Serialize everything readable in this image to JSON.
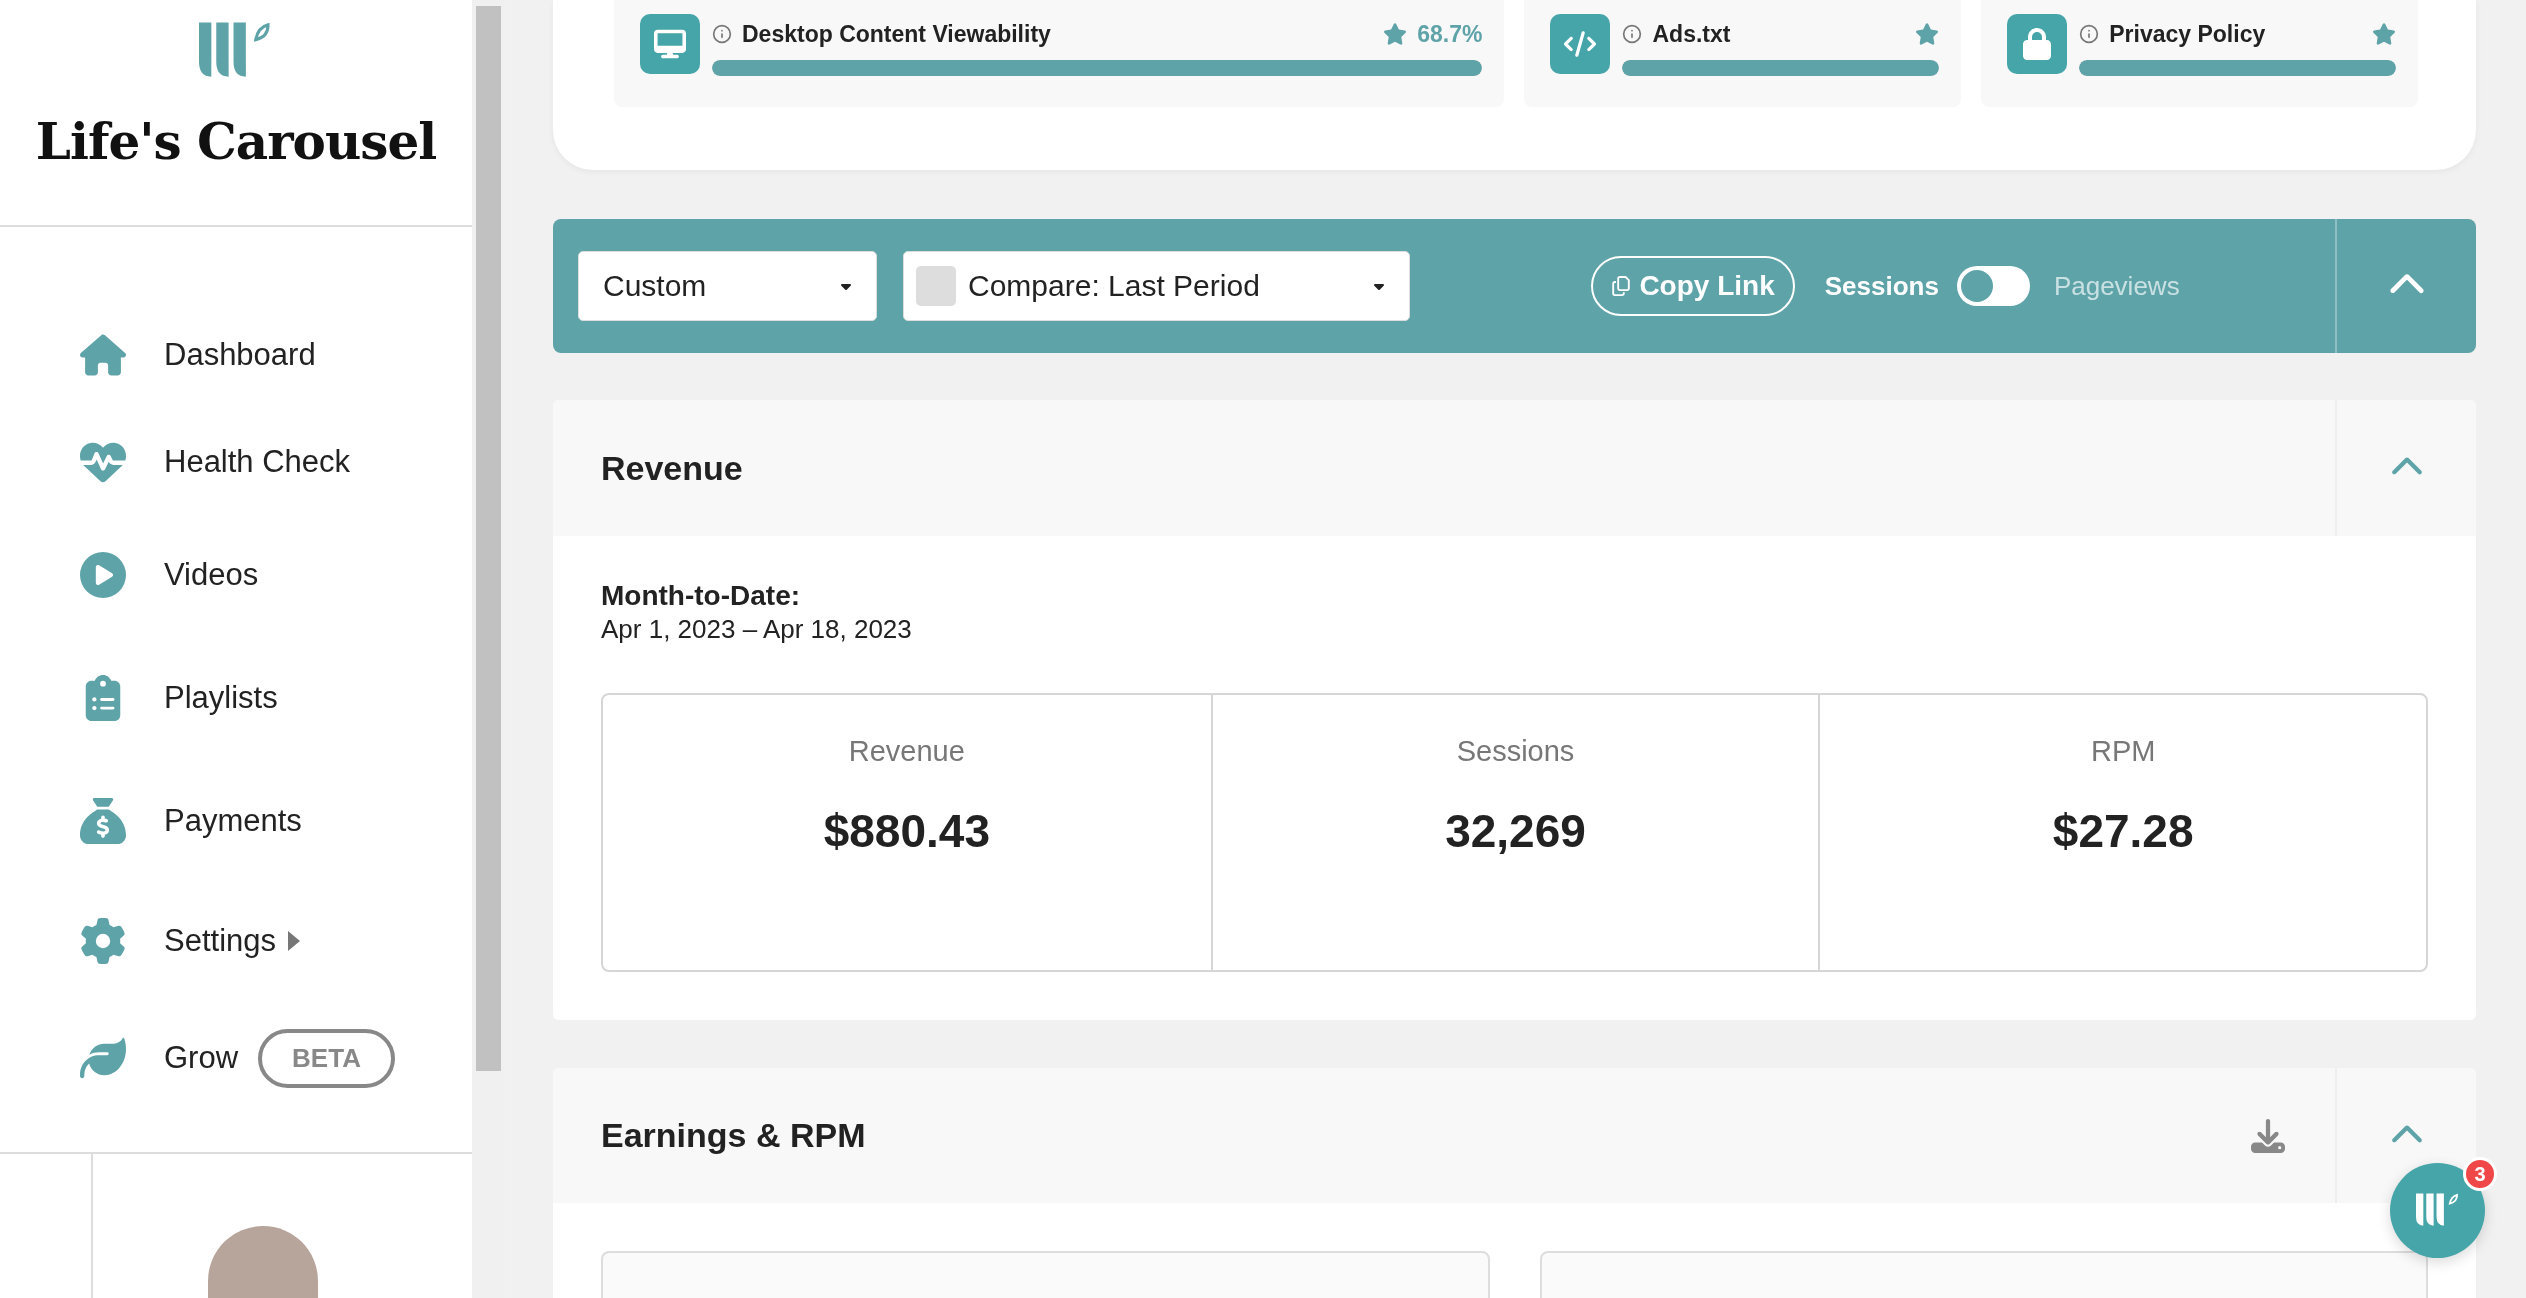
{
  "sidebar": {
    "brand": "Life's Carousel",
    "nav": [
      {
        "kind": "home",
        "label": "Dashboard"
      },
      {
        "kind": "health",
        "label": "Health Check"
      },
      {
        "kind": "videos",
        "label": "Videos"
      },
      {
        "kind": "playlists",
        "label": "Playlists"
      },
      {
        "kind": "payments",
        "label": "Payments"
      },
      {
        "kind": "settings",
        "label": "Settings",
        "submenu": true
      },
      {
        "kind": "grow",
        "label": "Grow",
        "badge": "BETA"
      }
    ]
  },
  "score_cards": [
    {
      "kind": "viewability",
      "label": "Desktop Content Viewability",
      "score": "68.7%",
      "level": 1
    },
    {
      "kind": "ads",
      "label": "Ads.txt",
      "level": 1
    },
    {
      "kind": "privacy",
      "label": "Privacy Policy",
      "level": 1
    }
  ],
  "filter_bar": {
    "date_range": "Custom",
    "compare": "Compare: Last Period",
    "copy_link": "Copy Link",
    "metric_toggle": [
      {
        "label": "Sessions",
        "selected": true
      },
      {
        "label": "Pageviews",
        "selected": false
      }
    ],
    "expanded": true
  },
  "revenue": {
    "title": "Revenue",
    "expanded": true,
    "period_label": "Month-to-Date:",
    "period_range": "Apr 1, 2023 – Apr 18, 2023",
    "stats": [
      {
        "label": "Revenue",
        "value": "$880.43"
      },
      {
        "label": "Sessions",
        "value": "32,269"
      },
      {
        "label": "RPM",
        "value": "$27.28"
      }
    ]
  },
  "earnings": {
    "title": "Earnings & RPM",
    "expanded": true
  },
  "chat": {
    "badge": "3"
  }
}
